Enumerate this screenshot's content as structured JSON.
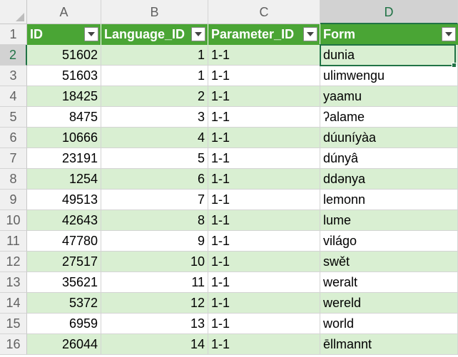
{
  "columns": [
    {
      "letter": "A",
      "table_header": "ID"
    },
    {
      "letter": "B",
      "table_header": "Language_ID"
    },
    {
      "letter": "C",
      "table_header": "Parameter_ID"
    },
    {
      "letter": "D",
      "table_header": "Form"
    }
  ],
  "header_row_number": "1",
  "rows": [
    {
      "num": "2",
      "id": "51602",
      "language_id": "1",
      "parameter_id": "1-1",
      "form": "dunia"
    },
    {
      "num": "3",
      "id": "51603",
      "language_id": "1",
      "parameter_id": "1-1",
      "form": "ulimwengu"
    },
    {
      "num": "4",
      "id": "18425",
      "language_id": "2",
      "parameter_id": "1-1",
      "form": "yaamu"
    },
    {
      "num": "5",
      "id": "8475",
      "language_id": "3",
      "parameter_id": "1-1",
      "form": "ʔalame"
    },
    {
      "num": "6",
      "id": "10666",
      "language_id": "4",
      "parameter_id": "1-1",
      "form": "dúuníyàa"
    },
    {
      "num": "7",
      "id": "23191",
      "language_id": "5",
      "parameter_id": "1-1",
      "form": "dúnyâ"
    },
    {
      "num": "8",
      "id": "1254",
      "language_id": "6",
      "parameter_id": "1-1",
      "form": "ddənya"
    },
    {
      "num": "9",
      "id": "49513",
      "language_id": "7",
      "parameter_id": "1-1",
      "form": "lemonn"
    },
    {
      "num": "10",
      "id": "42643",
      "language_id": "8",
      "parameter_id": "1-1",
      "form": "lume"
    },
    {
      "num": "11",
      "id": "47780",
      "language_id": "9",
      "parameter_id": "1-1",
      "form": "világo"
    },
    {
      "num": "12",
      "id": "27517",
      "language_id": "10",
      "parameter_id": "1-1",
      "form": "swět"
    },
    {
      "num": "13",
      "id": "35621",
      "language_id": "11",
      "parameter_id": "1-1",
      "form": "weralt"
    },
    {
      "num": "14",
      "id": "5372",
      "language_id": "12",
      "parameter_id": "1-1",
      "form": "wereld"
    },
    {
      "num": "15",
      "id": "6959",
      "language_id": "13",
      "parameter_id": "1-1",
      "form": "world"
    },
    {
      "num": "16",
      "id": "26044",
      "language_id": "14",
      "parameter_id": "1-1",
      "form": "ēllmannt"
    }
  ],
  "selected_column": "D",
  "selected_row": "2",
  "colors": {
    "table_header": "#4aa535",
    "band": "#d9efd2",
    "selection": "#217346"
  },
  "icons": {
    "filter": "dropdown-filter-icon",
    "corner": "select-all-triangle-icon"
  }
}
